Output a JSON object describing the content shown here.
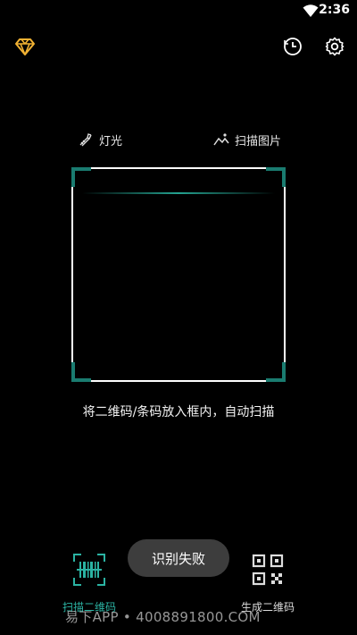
{
  "status_bar": {
    "time": "2:36"
  },
  "tools": {
    "light_label": "灯光",
    "picture_label": "扫描图片"
  },
  "hint": "将二维码/条码放入框内，自动扫描",
  "tabs": {
    "scan_label": "扫描二维码",
    "generate_label": "生成二维码"
  },
  "toast": "识别失败",
  "watermark": "易下APP • 4008891800.COM",
  "colors": {
    "accent": "#2bb3a3",
    "corner": "#1a7c70",
    "vip": "#f2b233",
    "background": "#000000"
  },
  "icons": {
    "vip": "diamond-icon",
    "history": "clock-icon",
    "settings": "gear-icon",
    "light": "flashlight-icon",
    "picture": "image-icon",
    "scan": "barcode-scan-icon",
    "generate": "qr-code-icon"
  }
}
